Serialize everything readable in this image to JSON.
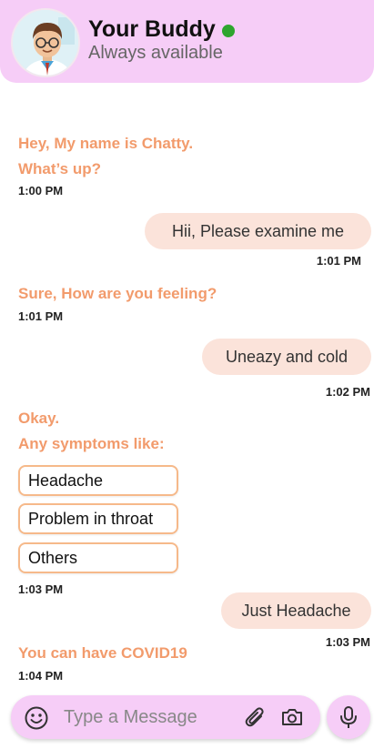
{
  "header": {
    "title": "Your Buddy",
    "subtitle": "Always available",
    "status_color": "#2ea52e",
    "avatar_icon": "doctor-avatar"
  },
  "messages": [
    {
      "sender": "bot",
      "lines": [
        "Hey, My name is Chatty.",
        "What’s up?"
      ],
      "time": "1:00 PM"
    },
    {
      "sender": "user",
      "text": "Hii, Please examine me",
      "time": "1:01 PM"
    },
    {
      "sender": "bot",
      "lines": [
        "Sure, How are you feeling?"
      ],
      "time": "1:01 PM"
    },
    {
      "sender": "user",
      "text": "Uneazy and cold",
      "time": "1:02 PM"
    },
    {
      "sender": "bot",
      "lines": [
        "Okay.",
        "Any symptoms like:"
      ],
      "options": [
        "Headache",
        "Problem in throat",
        "Others"
      ],
      "time": "1:03 PM"
    },
    {
      "sender": "user",
      "text": "Just Headache",
      "time": "1:03 PM"
    },
    {
      "sender": "bot",
      "lines": [
        "You can have COVID19"
      ],
      "time": "1:04 PM"
    }
  ],
  "input": {
    "placeholder": "Type a Message",
    "icons": [
      "emoji-icon",
      "attachment-icon",
      "camera-icon",
      "microphone-icon"
    ]
  },
  "colors": {
    "header_bg": "#f6cdf7",
    "bot_text": "#f29b6c",
    "user_bubble": "#fbe3da",
    "option_border": "#f6b98a"
  }
}
